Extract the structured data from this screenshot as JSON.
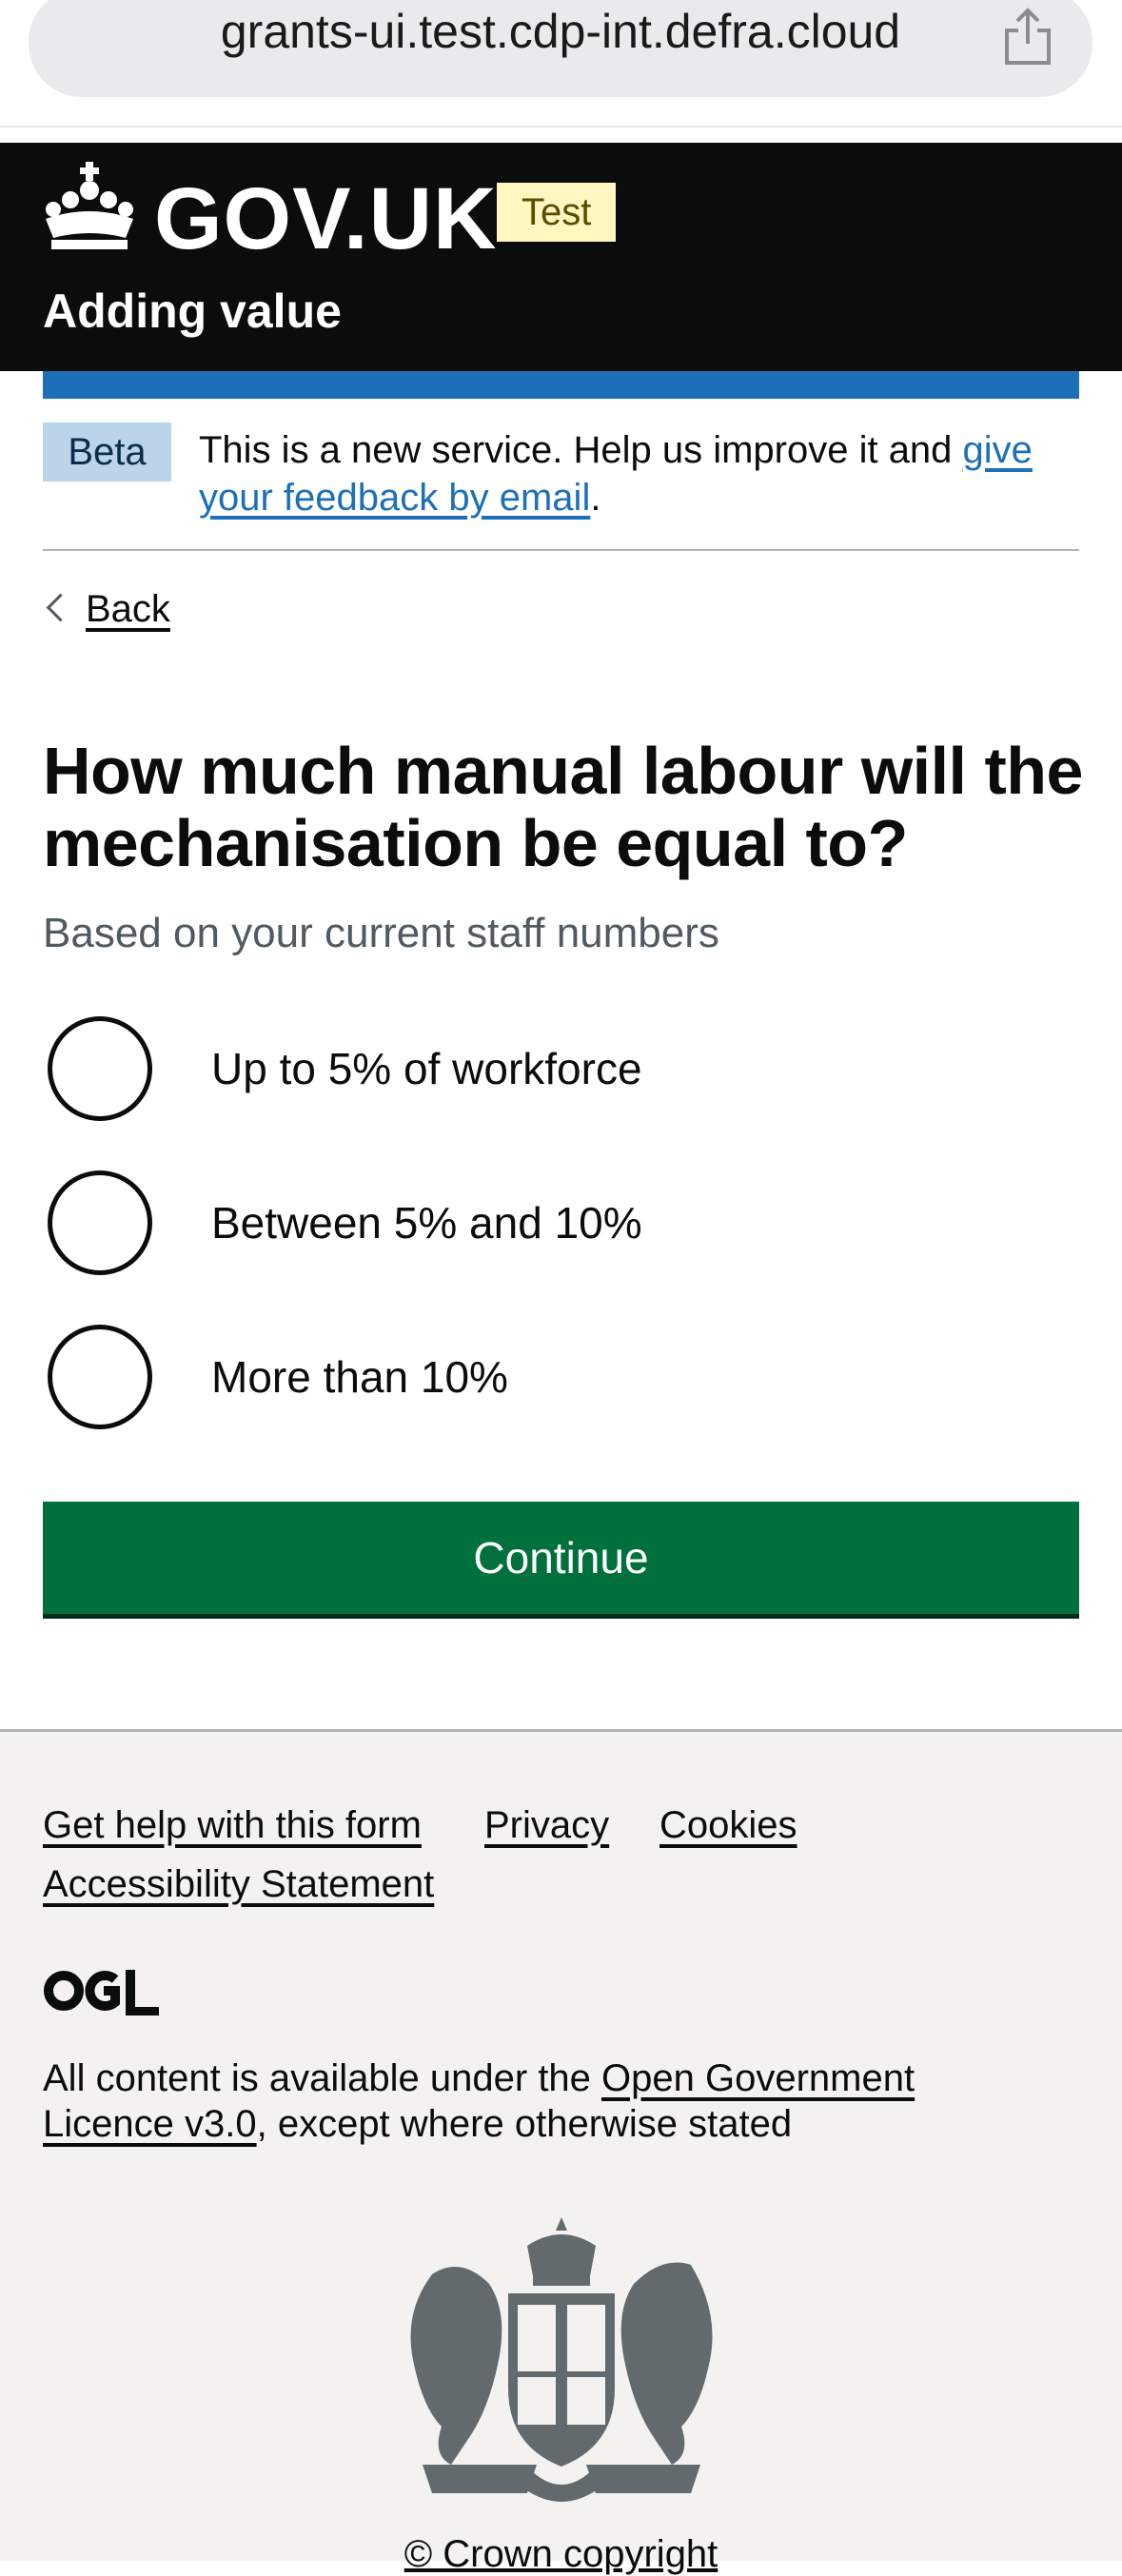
{
  "browser": {
    "url": "grants-ui.test.cdp-int.defra.cloud",
    "share_icon": "share-icon"
  },
  "header": {
    "logo_text": "GOV.UK",
    "environment_tag": "Test",
    "service_name": "Adding value"
  },
  "phase_banner": {
    "tag": "Beta",
    "text_before": "This is a new service. Help us improve it and ",
    "link_text": "give your feedback by email",
    "text_after": "."
  },
  "back_link": "Back",
  "question": {
    "heading": "How much manual labour will the mechanisation be equal to?",
    "hint": "Based on your current staff numbers",
    "options": [
      "Up to 5% of workforce",
      "Between 5% and 10%",
      "More than 10%"
    ]
  },
  "continue_label": "Continue",
  "footer": {
    "links": [
      "Get help with this form",
      "Privacy",
      "Cookies",
      "Accessibility Statement"
    ],
    "licence_before": "All content is available under the ",
    "licence_link": "Open Government Licence v3.0",
    "licence_after": ", except where otherwise stated",
    "copyright": "© Crown copyright"
  },
  "colors": {
    "header_bg": "#0b0c0c",
    "brand_blue": "#1d70b8",
    "button_green": "#00703c",
    "footer_bg": "#f3f2f1",
    "test_tag_bg": "#fff7bf",
    "beta_tag_bg": "#bbd4ea"
  }
}
